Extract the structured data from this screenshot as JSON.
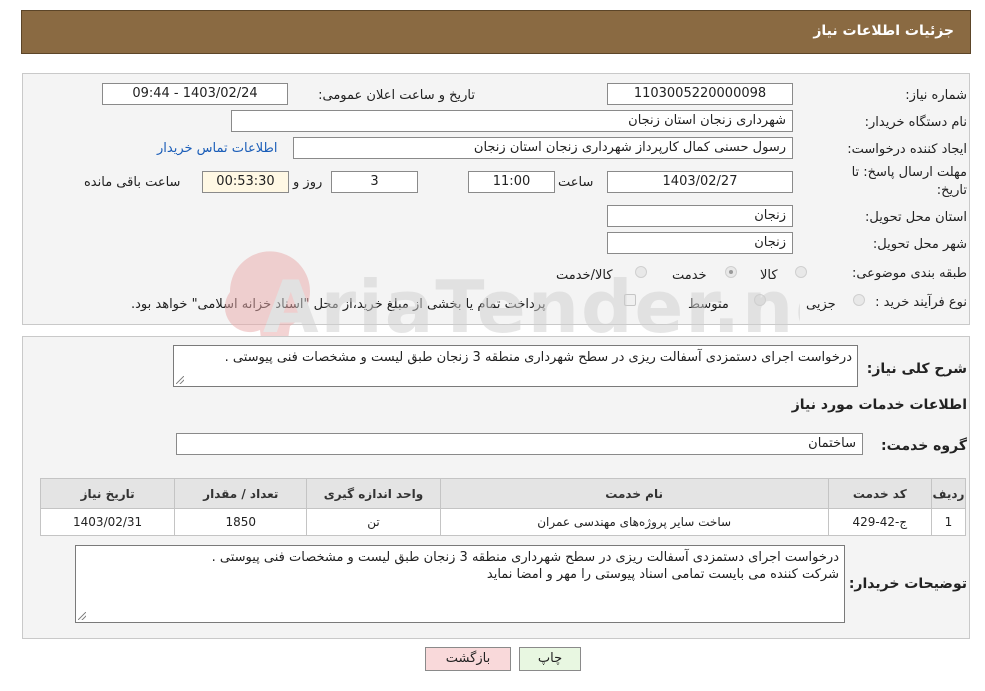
{
  "header": {
    "title": "جزئیات اطلاعات نیاز"
  },
  "form": {
    "need_number": {
      "label": "شماره نیاز:",
      "value": "1103005220000098"
    },
    "announce_datetime": {
      "label": "تاریخ و ساعت اعلان عمومی:",
      "value": "1403/02/24 - 09:44"
    },
    "buyer_org": {
      "label": "نام دستگاه خریدار:",
      "value": "شهرداری زنجان استان زنجان"
    },
    "requester": {
      "label": "ایجاد کننده درخواست:",
      "value": "رسول حسنی کمال کارپرداز شهرداری زنجان استان زنجان",
      "contact_link": "اطلاعات تماس خریدار"
    },
    "deadline": {
      "label_line1": "مهلت ارسال پاسخ: تا",
      "label_line2": "تاریخ:",
      "date": "1403/02/27",
      "time_label": "ساعت",
      "time": "11:00",
      "days": "3",
      "days_label": "روز و",
      "remaining": "00:53:30",
      "remaining_label": "ساعت باقی مانده"
    },
    "delivery_province": {
      "label": "استان محل تحویل:",
      "value": "زنجان"
    },
    "delivery_city": {
      "label": "شهر محل تحویل:",
      "value": "زنجان"
    },
    "category": {
      "label": "طبقه بندی موضوعی:",
      "options": [
        "کالا",
        "خدمت",
        "کالا/خدمت"
      ],
      "selected": "خدمت"
    },
    "purchase_type": {
      "label": "نوع فرآیند خرید :",
      "options": [
        "جزیی",
        "متوسط"
      ],
      "note": "پرداخت تمام یا بخشی از مبلغ خرید،از محل \"اسناد خزانه اسلامی\" خواهد بود."
    }
  },
  "description": {
    "label": "شرح کلی نیاز:",
    "value": "درخواست اجرای دستمزدی آسفالت ریزی در سطح شهرداری منطقه 3 زنجان طبق لیست و مشخصات فنی پیوستی ."
  },
  "services": {
    "section_title": "اطلاعات خدمات مورد نیاز",
    "group_label": "گروه خدمت:",
    "group_value": "ساختمان",
    "table": {
      "headers": [
        "ردیف",
        "کد خدمت",
        "نام خدمت",
        "واحد اندازه گیری",
        "تعداد / مقدار",
        "تاریخ نیاز"
      ],
      "rows": [
        [
          "1",
          "ج-42-429",
          "ساخت سایر پروژه‌های مهندسی عمران",
          "تن",
          "1850",
          "1403/02/31"
        ]
      ]
    }
  },
  "buyer_notes": {
    "label": "توضیحات خریدار:",
    "line1": "درخواست اجرای دستمزدی آسفالت ریزی در سطح شهرداری منطقه 3 زنجان طبق لیست و مشخصات فنی پیوستی .",
    "line2": "شرکت کننده می بایست تمامی اسناد پیوستی را مهر و امضا نماید"
  },
  "buttons": {
    "print": "چاپ",
    "back": "بازگشت"
  },
  "watermark_text": "AriaTender.neT",
  "colors": {
    "header_bg": "#8a6a42",
    "link": "#1a5db8",
    "print_bg": "#e8f7e1",
    "back_bg": "#f9d9da"
  }
}
